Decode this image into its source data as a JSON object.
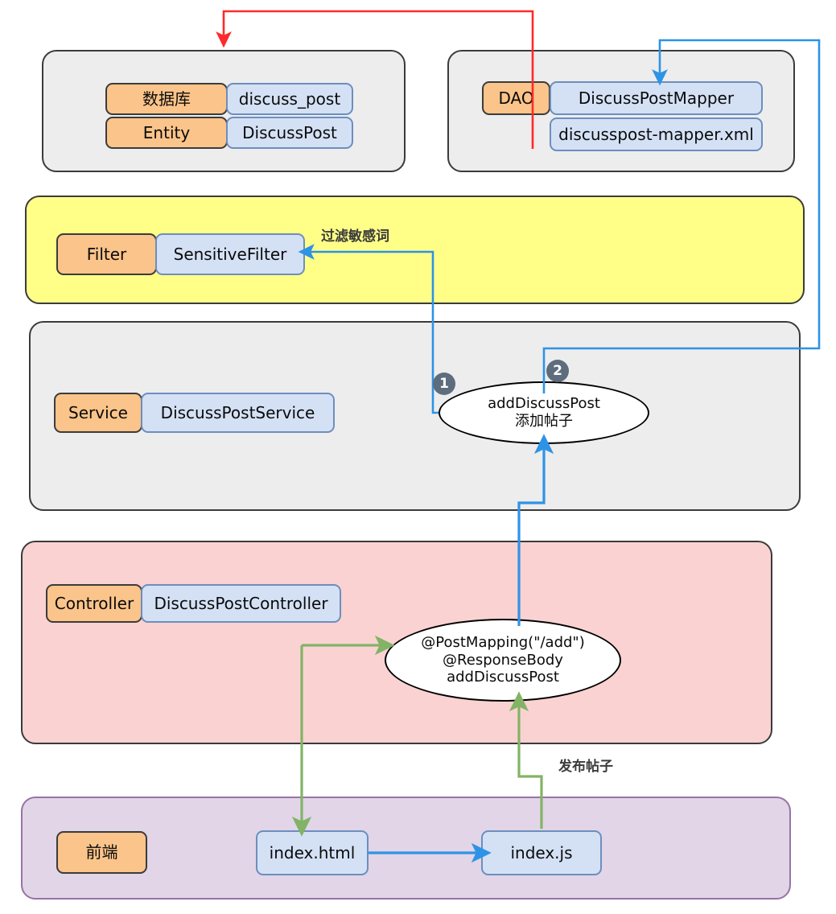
{
  "diagram": {
    "title": "DiscussPost add flow architecture",
    "colors": {
      "tag_fill": "#fbc48a",
      "class_fill": "#d4e1f5",
      "class_border": "#6c8ebf",
      "panel_gray": "#ededed",
      "panel_yellow": "#ffff88",
      "panel_pink": "#fad2d2",
      "panel_purple": "#e1d5e7",
      "arrow_red": "#ff2a2a",
      "arrow_blue": "#2e93e6",
      "arrow_green": "#82b366",
      "badge_fill": "#5d6d7e"
    },
    "layers": {
      "database": {
        "tag": "数据库",
        "class": "discuss_post",
        "tag2": "Entity",
        "class2": "DiscussPost"
      },
      "dao": {
        "tag": "DAO",
        "class": "DiscussPostMapper",
        "class2": "discusspost-mapper.xml"
      },
      "filter": {
        "tag": "Filter",
        "class": "SensitiveFilter"
      },
      "service": {
        "tag": "Service",
        "class": "DiscussPostService"
      },
      "controller": {
        "tag": "Controller",
        "class": "DiscussPostController"
      },
      "frontend": {
        "tag": "前端",
        "html": "index.html",
        "js": "index.js"
      }
    },
    "ellipses": {
      "service_method": {
        "line1": "addDiscussPost",
        "line2": "添加帖子"
      },
      "controller_method": {
        "line1": "@PostMapping(\"/add\")",
        "line2": "@ResponseBody",
        "line3": "addDiscussPost"
      }
    },
    "badges": [
      {
        "number": "1"
      },
      {
        "number": "2"
      }
    ],
    "edge_labels": [
      {
        "text": "过滤敏感词"
      },
      {
        "text": "发布帖子"
      }
    ]
  }
}
